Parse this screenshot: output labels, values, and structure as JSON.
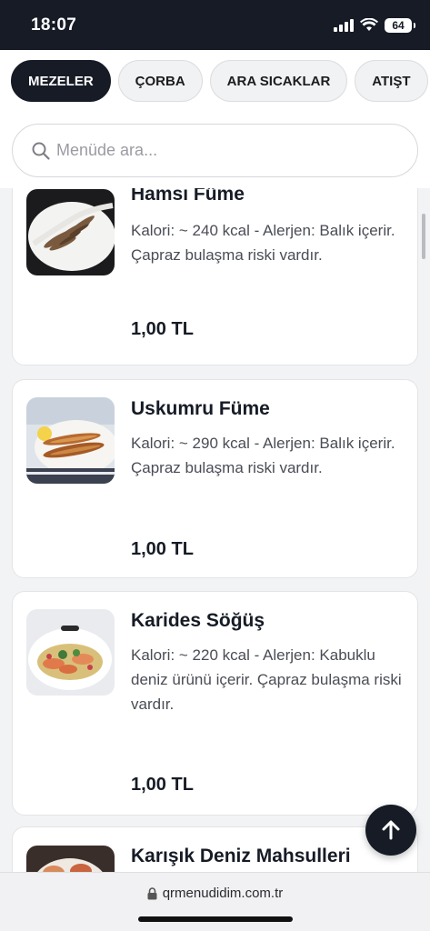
{
  "status": {
    "time": "18:07",
    "battery": "64"
  },
  "categories": [
    {
      "label": "MEZELER"
    },
    {
      "label": "ÇORBA"
    },
    {
      "label": "ARA SICAKLAR"
    },
    {
      "label": "ATIŞT"
    }
  ],
  "search": {
    "placeholder": "Menüde ara..."
  },
  "items": [
    {
      "title": "Hamsi Füme",
      "desc": "Kalori: ~ 240 kcal - Alerjen: Balık içerir. Çapraz bulaşma riski vardır.",
      "price": "1,00 TL"
    },
    {
      "title": "Uskumru Füme",
      "desc": "Kalori: ~ 290 kcal - Alerjen: Balık içerir. Çapraz bulaşma riski vardır.",
      "price": "1,00 TL"
    },
    {
      "title": "Karides Söğüş",
      "desc": "Kalori: ~ 220 kcal - Alerjen: Kabuklu deniz ürünü içerir. Çapraz bulaşma riski vardır.",
      "price": "1,00 TL"
    },
    {
      "title": "Karışık Deniz Mahsulleri",
      "desc": "",
      "price": ""
    }
  ],
  "browser": {
    "url": "qrmenudidim.com.tr"
  },
  "colors": {
    "dark": "#161b26",
    "page_bg": "#f2f3f5",
    "card_border": "#e3e4e7"
  }
}
